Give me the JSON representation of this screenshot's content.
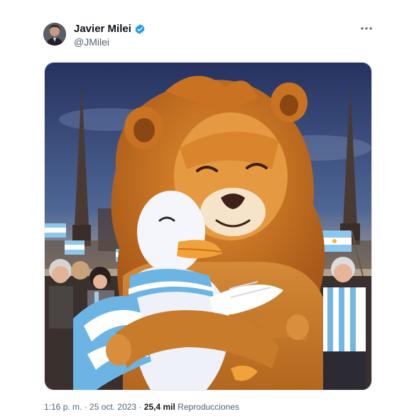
{
  "author": {
    "name": "Javier Milei",
    "handle": "@JMilei",
    "verified": true,
    "verified_color": "#1d9bf0",
    "avatar_icon": "profile-photo"
  },
  "menu": {
    "icon": "more-horizontal-icon"
  },
  "media": {
    "kind": "illustration",
    "palette": {
      "sky_top": "#2c3a6b",
      "sky_bottom": "#f2c98b",
      "lion_mane": "#c9721f",
      "lion_face": "#e8a44a",
      "duck": "#f4f6fb",
      "beak": "#f2a23a",
      "flag_blue": "#6cb4e4",
      "flag_white": "#ffffff"
    }
  },
  "meta": {
    "time": "1:16 p. m.",
    "separator_1": " · ",
    "date": "25 oct. 2023",
    "separator_2": " · ",
    "views_count": "25,4 mil",
    "views_label": " Reproducciones"
  }
}
